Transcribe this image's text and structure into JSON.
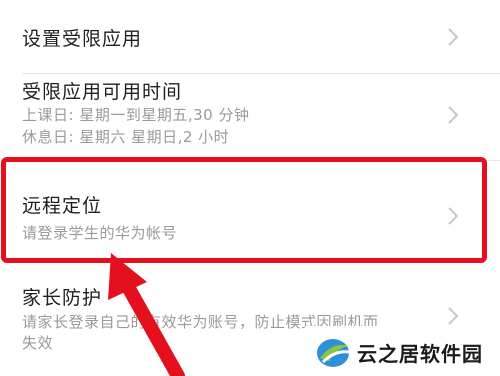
{
  "settings": {
    "items": [
      {
        "title": "设置受限应用"
      },
      {
        "title": "受限应用可用时间",
        "sub1": "上课日: 星期一到星期五,30 分钟",
        "sub2": "休息日: 星期六 星期日,2 小时"
      },
      {
        "title": "远程定位",
        "sub1": "请登录学生的华为帐号"
      },
      {
        "title": "家长防护",
        "sub1": "请家长登录自己的有效华为账号，防止模式因刷机而",
        "sub2": "失效"
      }
    ]
  },
  "icons": {
    "chevron": "chevron-right-icon",
    "arrow": "red-pointer-arrow",
    "logo": "yunzhiju-logo"
  },
  "colors": {
    "highlight": "#e4101e",
    "text": "#1f1f1f",
    "subtext": "#9a9a9a"
  },
  "watermark": {
    "text": "云之居软件园"
  }
}
